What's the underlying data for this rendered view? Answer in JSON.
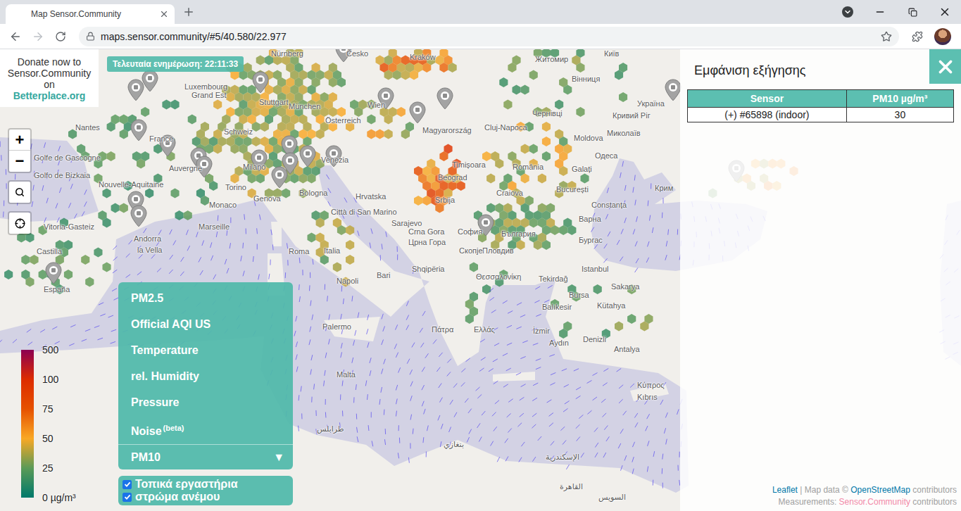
{
  "window": {
    "title": "Map Sensor.Community"
  },
  "address_bar": {
    "url": "maps.sensor.community/#5/40.580/22.977"
  },
  "donate": {
    "lines": [
      "Donate now to",
      "Sensor.Community",
      "on"
    ],
    "link": "Betterplace.org"
  },
  "last_update": "Τελευταία ενημέρωση: 22:11:33",
  "zoom": {
    "in": "+",
    "out": "−"
  },
  "info_panel": {
    "title": "Εμφάνιση εξήγησης",
    "table": {
      "columns": [
        "Sensor",
        "PM10 µg/m³"
      ],
      "rows": [
        [
          "(+) #65898 (indoor)",
          "30"
        ]
      ]
    }
  },
  "legend": {
    "ticks": [
      "500",
      "100",
      "75",
      "50",
      "25",
      "0 µg/m³"
    ]
  },
  "menu": {
    "options": [
      {
        "label": "PM2.5",
        "selected": false
      },
      {
        "label": "Official AQI US",
        "selected": false
      },
      {
        "label": "Temperature",
        "selected": false
      },
      {
        "label": "rel. Humidity",
        "selected": false
      },
      {
        "label": "Pressure",
        "selected": false
      },
      {
        "label": "Noise",
        "sup": "(beta)",
        "selected": false
      },
      {
        "label": "PM10",
        "selected": true
      }
    ],
    "caret": "▼"
  },
  "layers": [
    {
      "label": "Τοπικά εργαστήρια",
      "checked": true
    },
    {
      "label": "στρώμα ανέμου",
      "checked": true
    }
  ],
  "attribution": [
    [
      {
        "text": "Leaflet",
        "link": true,
        "color": "#0078a8"
      },
      {
        "text": " | Map data © ",
        "link": false
      },
      {
        "text": "OpenStreetMap",
        "link": true,
        "color": "#0078a8"
      },
      {
        "text": " contributors",
        "link": false
      }
    ],
    [
      {
        "text": "Measurements: ",
        "link": false
      },
      {
        "text": "Sensor.Community",
        "link": true,
        "color": "#f28aa8"
      },
      {
        "text": " contributors",
        "link": false
      }
    ]
  ],
  "map": {
    "labels": [
      "Luxembourg",
      "Nürnberg",
      "Česko",
      "Kraków",
      "Житомир",
      "Київ",
      "Вінниця",
      "Grand Est",
      "Stuttgart",
      "München",
      "Österreich",
      "Wien",
      "Nantes",
      "France",
      "Magyarország",
      "Чернівці",
      "Кривий Ріг",
      "Україна",
      "Миколаїв",
      "Cluj-Napoca",
      "Moldova",
      "Schweiz",
      "Golfe de Gascogne",
      "Golfo de Bizkaia",
      "Timișoara",
      "România",
      "Galați",
      "Одеса",
      "Milano",
      "Venezia",
      "Auvergne",
      "Nouvelle-Aquitaine",
      "Torino",
      "Bologna",
      "Hrvatska",
      "Genova",
      "Beograd",
      "Srbija",
      "Craiova",
      "București",
      "Крим",
      "Monaco",
      "Città di San Marino",
      "Constanța",
      "Sarajevo",
      "Marseille",
      "Vitoria-Gasteiz",
      "Crna Gora",
      "Црна Гора",
      "София",
      "България",
      "Варна",
      "Бургас",
      "Пловдив",
      "Скопје",
      "Andorra",
      "la Vella",
      "Castilla",
      "Roma",
      "Italia",
      "Shqipëria",
      "Istanbul",
      "Θεσσαλονίκη",
      "Napoli",
      "Bari",
      "Tekirdağ",
      "Sakarya",
      "España",
      "Bursa",
      "Balıkesir",
      "Kütahya",
      "Palermo",
      "Πάτρα",
      "Ελλάς",
      "İzmir",
      "Denizli",
      "Aydın",
      "Antalya",
      "Malta",
      "Κύπρος",
      "Kıbrıs",
      "طرابلس",
      "بنغازي",
      "الإسكندرية",
      "القاهرة",
      "السويس"
    ]
  }
}
